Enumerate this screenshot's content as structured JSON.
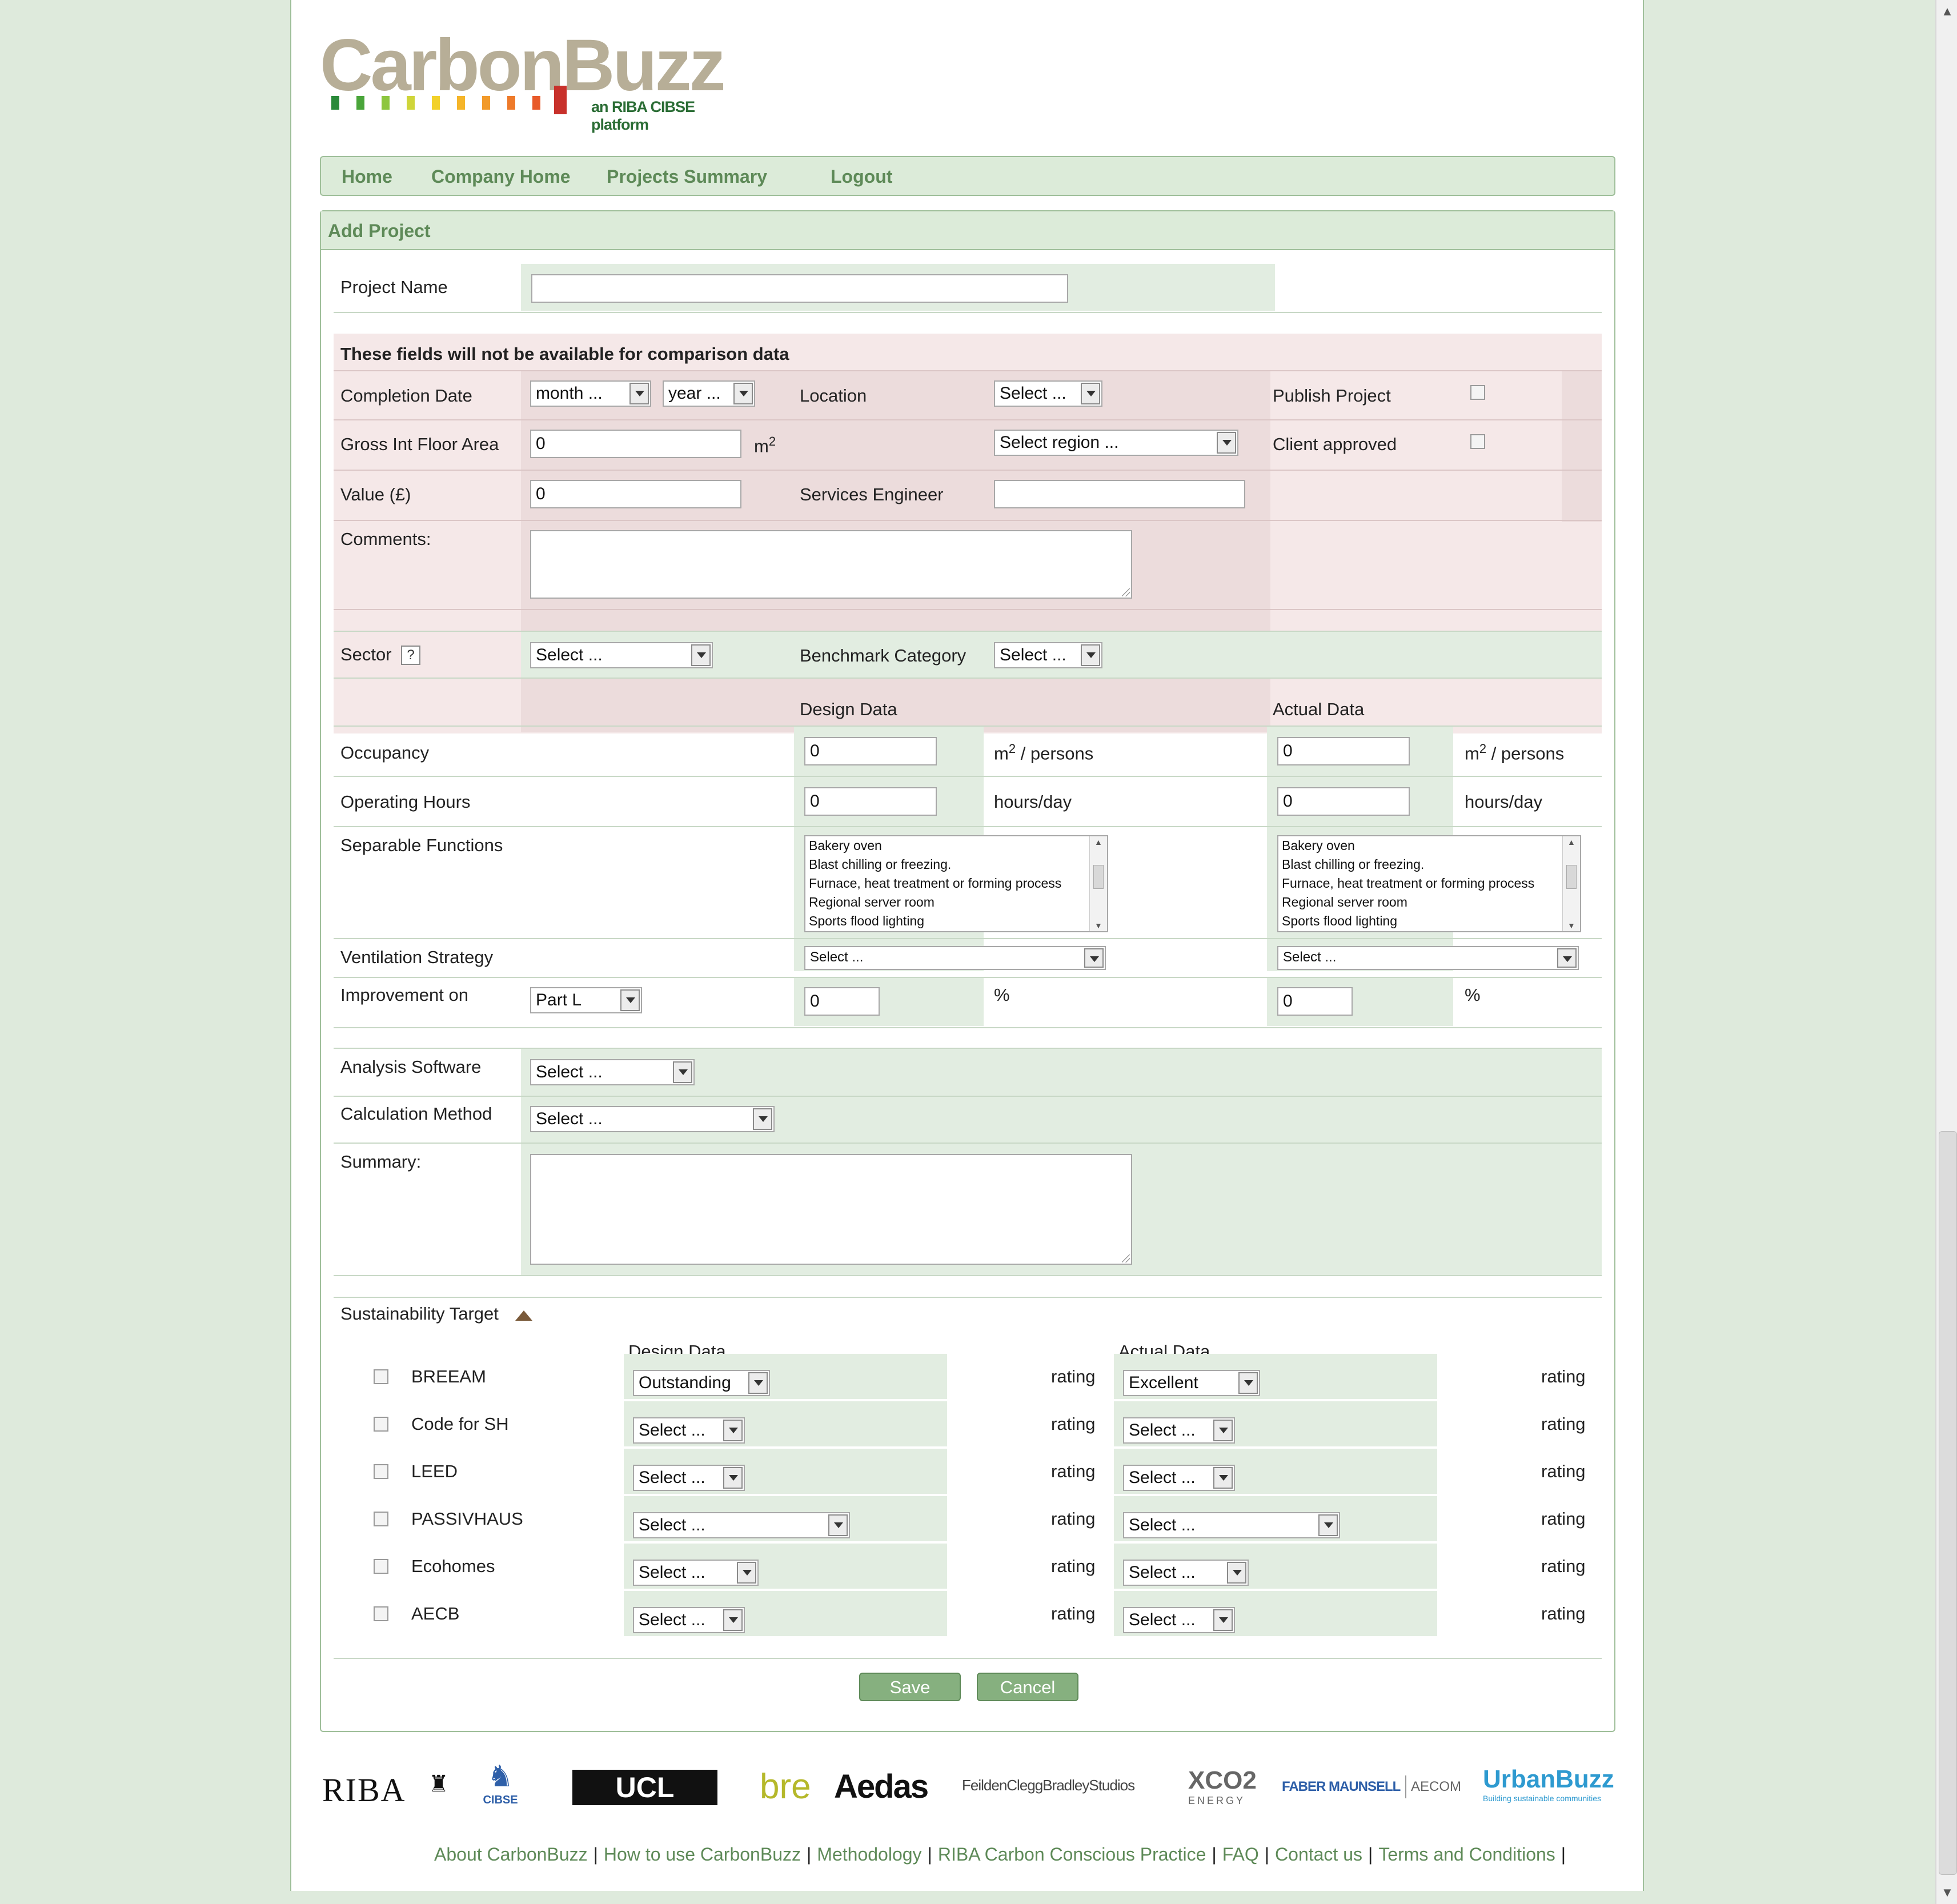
{
  "logo": {
    "name": "CarbonBuzz",
    "tagline": "an RIBA CIBSE platform",
    "bar_colors": [
      "#2a8a3a",
      "#4aa53a",
      "#8dc63f",
      "#cfd53a",
      "#f2d12a",
      "#f5b52a",
      "#f29a2a",
      "#ee7a2a",
      "#e85a2a",
      "#c8312b"
    ]
  },
  "nav": {
    "items": [
      "Home",
      "Company Home",
      "Projects Summary",
      "Logout"
    ]
  },
  "panel": {
    "title": "Add Project"
  },
  "form": {
    "project_name": {
      "label": "Project Name",
      "value": ""
    },
    "notice": "These fields will not be available for comparison data",
    "completion_date": {
      "label": "Completion Date",
      "month": "month ...",
      "year": "year ..."
    },
    "location": {
      "label": "Location",
      "value": "Select ..."
    },
    "region": {
      "value": "Select region ..."
    },
    "publish_project": {
      "label": "Publish Project"
    },
    "client_approved": {
      "label": "Client approved"
    },
    "gross_floor_area": {
      "label": "Gross Int Floor Area",
      "value": "0",
      "unit": "m",
      "unit_sup": "2"
    },
    "value": {
      "label": "Value (£)",
      "value": "0"
    },
    "services_engineer": {
      "label": "Services Engineer",
      "value": ""
    },
    "comments": {
      "label": "Comments:"
    },
    "sector": {
      "label": "Sector",
      "help": "?",
      "value": "Select ..."
    },
    "benchmark_category": {
      "label": "Benchmark Category",
      "value": "Select ..."
    },
    "design_data_header": "Design Data",
    "actual_data_header": "Actual Data",
    "occupancy": {
      "label": "Occupancy",
      "design": "0",
      "actual": "0",
      "unit_pre": "m",
      "unit_sup": "2",
      "unit_post": " / persons"
    },
    "operating_hours": {
      "label": "Operating Hours",
      "design": "0",
      "actual": "0",
      "unit": "hours/day"
    },
    "separable_functions": {
      "label": "Separable Functions",
      "options": [
        "Bakery oven",
        "Blast chilling or freezing.",
        "Furnace, heat treatment or forming process",
        "Regional server room",
        "Sports flood lighting"
      ]
    },
    "ventilation_strategy": {
      "label": "Ventilation Strategy",
      "design": "Select ...",
      "actual": "Select ..."
    },
    "improvement_on": {
      "label": "Improvement on",
      "value": "Part L",
      "design": "0",
      "actual": "0",
      "unit": "%"
    },
    "analysis_software": {
      "label": "Analysis Software",
      "value": "Select ..."
    },
    "calculation_method": {
      "label": "Calculation Method",
      "value": "Select ..."
    },
    "summary": {
      "label": "Summary:"
    }
  },
  "sustainability": {
    "title": "Sustainability Target",
    "design_header": "Design Data",
    "actual_header": "Actual Data",
    "rating_label": "rating",
    "rows": [
      {
        "name": "BREEAM",
        "design": "Outstanding",
        "actual": "Excellent"
      },
      {
        "name": "Code for SH",
        "design": "Select ...",
        "actual": "Select ..."
      },
      {
        "name": "LEED",
        "design": "Select ...",
        "actual": "Select ..."
      },
      {
        "name": "PASSIVHAUS",
        "design": "Select ...",
        "actual": "Select ..."
      },
      {
        "name": "Ecohomes",
        "design": "Select ...",
        "actual": "Select ..."
      },
      {
        "name": "AECB",
        "design": "Select ...",
        "actual": "Select ..."
      }
    ]
  },
  "buttons": {
    "save": "Save",
    "cancel": "Cancel"
  },
  "footer": {
    "logos": [
      "RIBA",
      "CIBSE",
      "UCL",
      "bre",
      "Aedas",
      "FeildenCleggBradleyStudios",
      "XCO2",
      "ENERGY",
      "FABER MAUNSELL",
      "AECOM",
      "UrbanBuzz",
      "Building sustainable communities"
    ],
    "links": [
      "About CarbonBuzz",
      "How to use CarbonBuzz",
      "Methodology",
      "RIBA Carbon Conscious Practice",
      "FAQ",
      "Contact us",
      "Terms and Conditions"
    ],
    "separator": "|"
  }
}
